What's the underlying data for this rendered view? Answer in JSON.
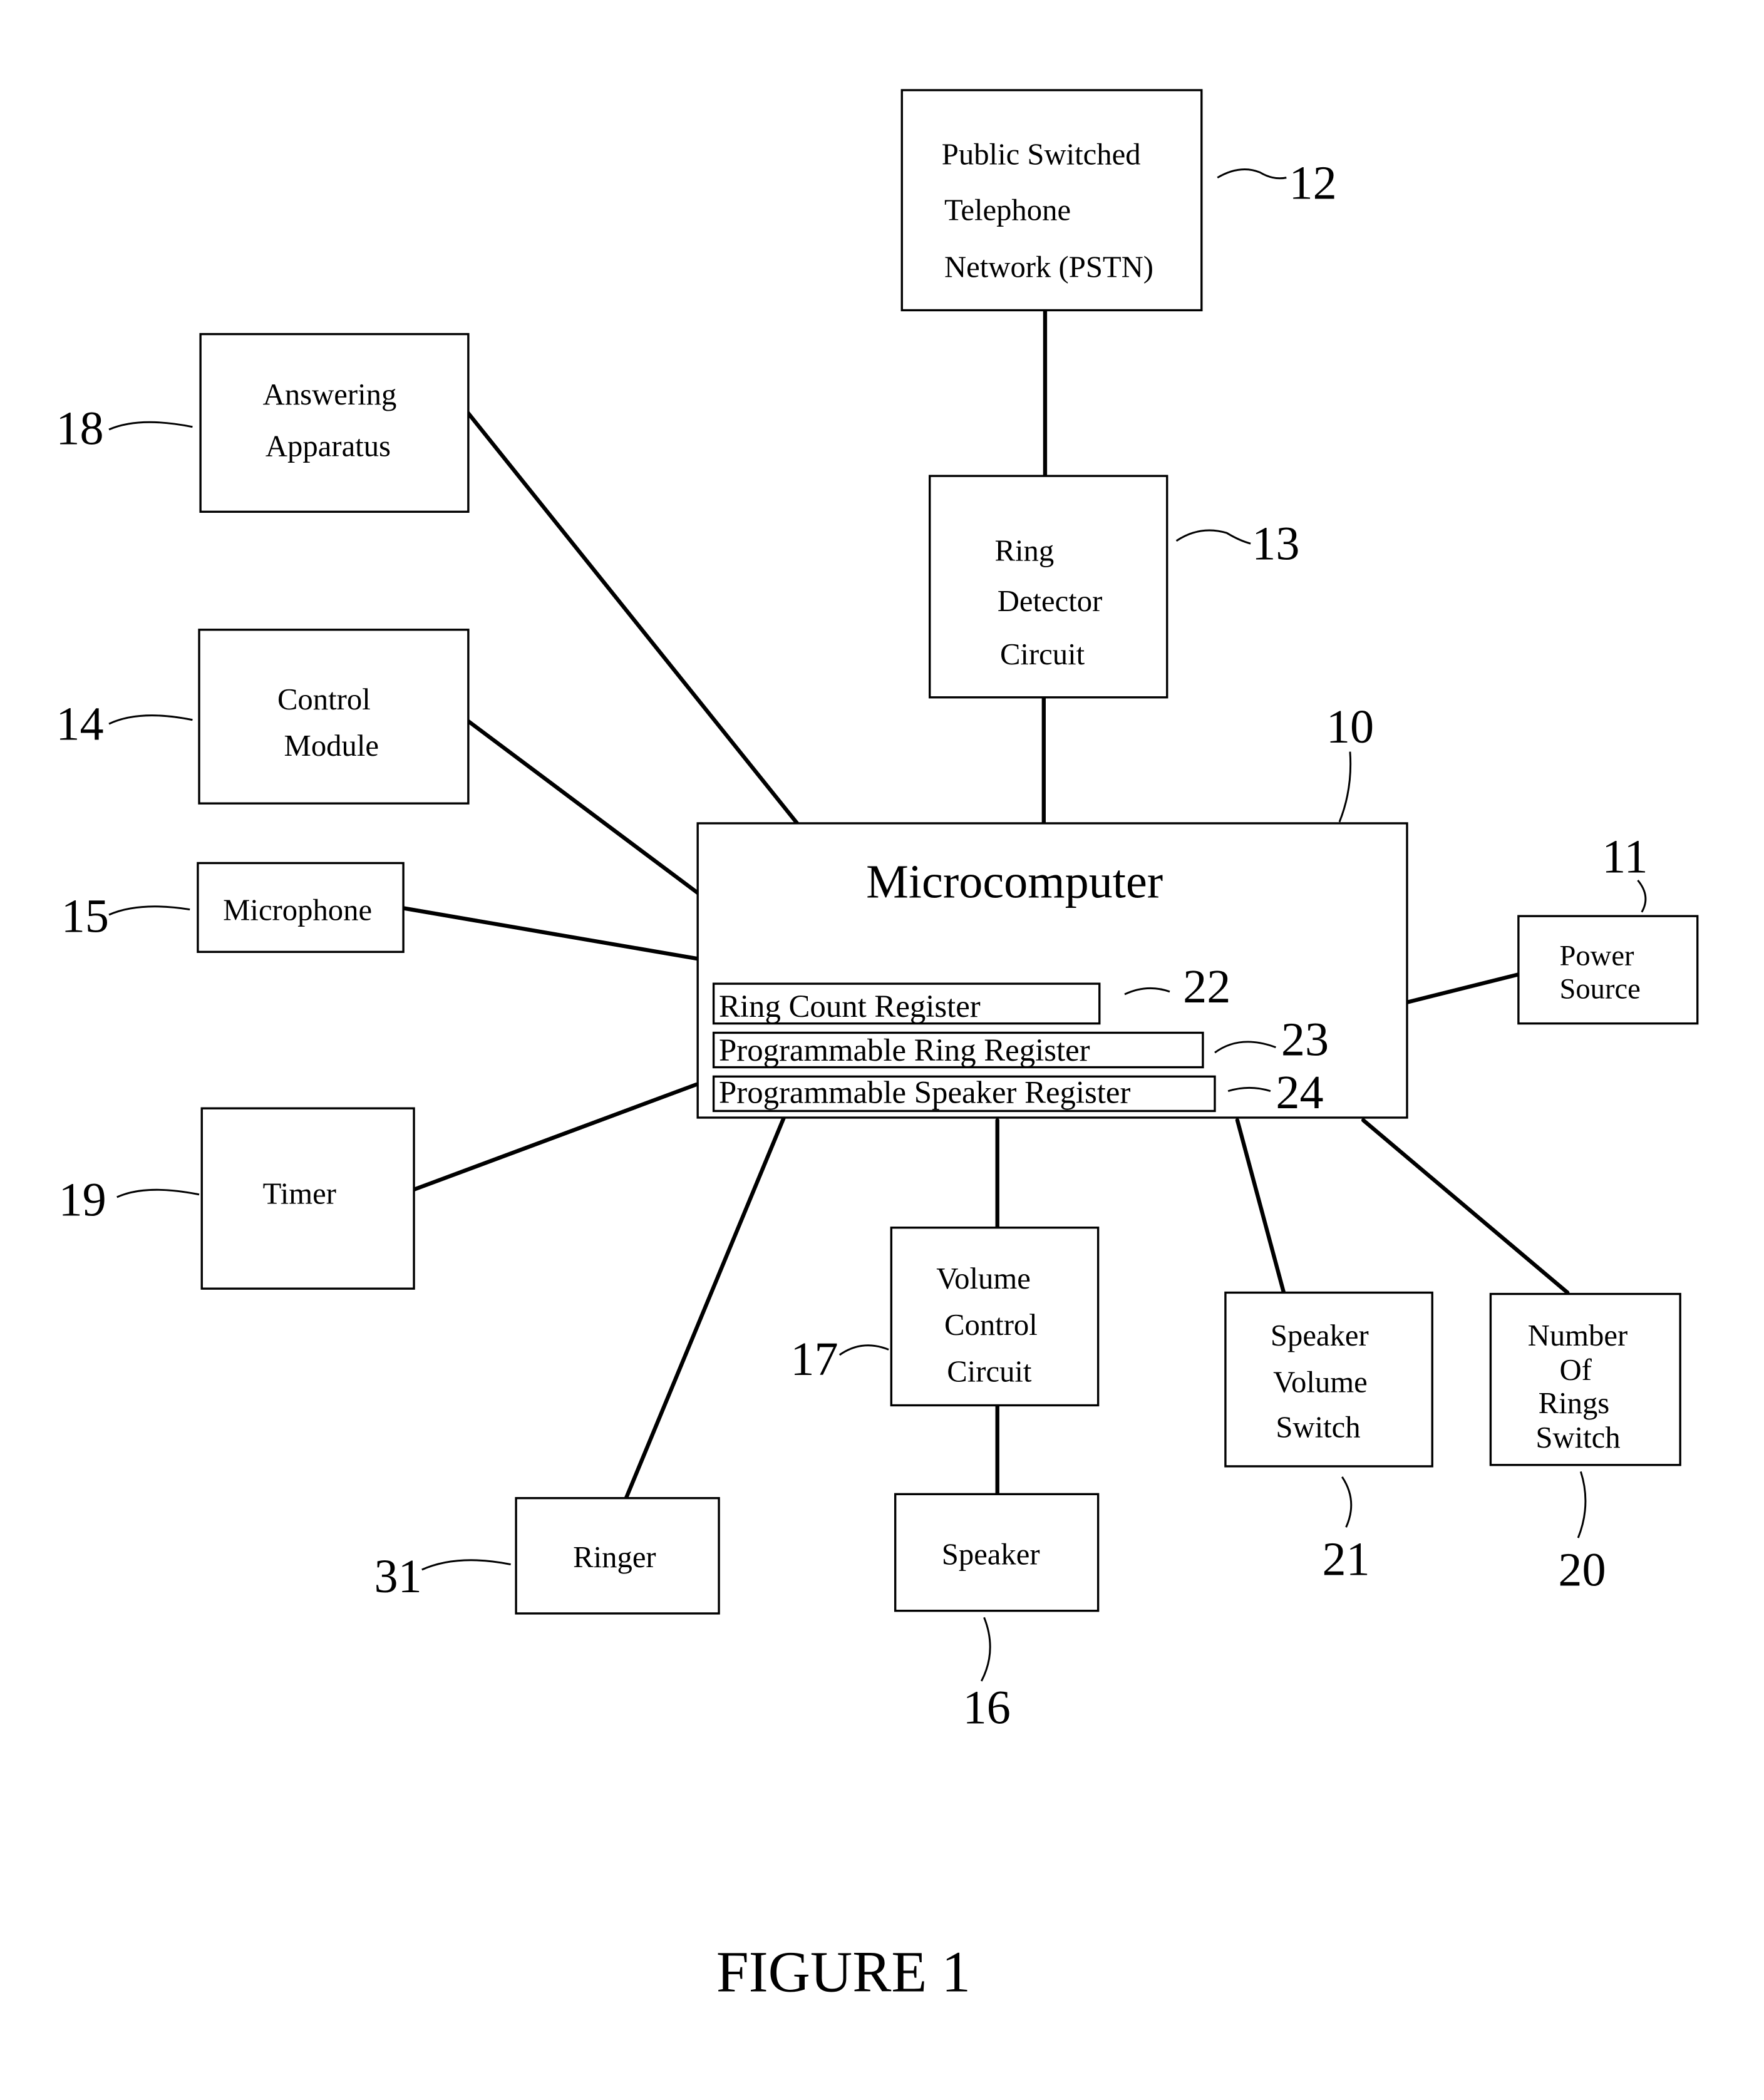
{
  "figure": {
    "caption": "FIGURE 1",
    "blocks": {
      "pstn": {
        "ref": "12",
        "lines": [
          "Public Switched",
          "Telephone",
          "Network (PSTN)"
        ]
      },
      "ring_detector": {
        "ref": "13",
        "lines": [
          "Ring",
          "Detector",
          "Circuit"
        ]
      },
      "answering": {
        "ref": "18",
        "lines": [
          "Answering",
          "Apparatus"
        ]
      },
      "control": {
        "ref": "14",
        "lines": [
          "Control",
          "Module"
        ]
      },
      "microphone": {
        "ref": "15",
        "lines": [
          "Microphone"
        ]
      },
      "microcomputer": {
        "ref": "10",
        "title": "Microcomputer",
        "registers": [
          {
            "ref": "22",
            "label": "Ring Count Register"
          },
          {
            "ref": "23",
            "label": "Programmable Ring Register"
          },
          {
            "ref": "24",
            "label": "Programmable Speaker Register"
          }
        ]
      },
      "power": {
        "ref": "11",
        "lines": [
          "Power",
          "Source"
        ]
      },
      "timer": {
        "ref": "19",
        "lines": [
          "Timer"
        ]
      },
      "volume_control": {
        "ref": "17",
        "lines": [
          "Volume",
          "Control",
          "Circuit"
        ]
      },
      "speaker_volume": {
        "ref": "21",
        "lines": [
          "Speaker",
          "Volume",
          "Switch"
        ]
      },
      "num_rings": {
        "ref": "20",
        "lines": [
          "Number",
          "Of",
          "Rings",
          "Switch"
        ]
      },
      "ringer": {
        "ref": "31",
        "lines": [
          "Ringer"
        ]
      },
      "speaker": {
        "ref": "16",
        "lines": [
          "Speaker"
        ]
      }
    }
  }
}
